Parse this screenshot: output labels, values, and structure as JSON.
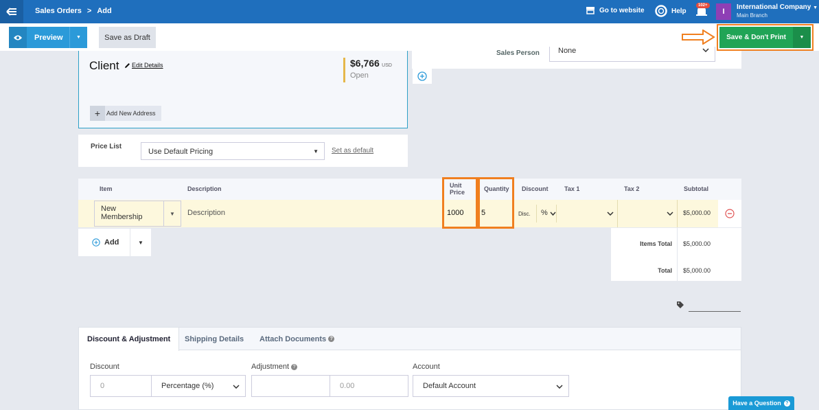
{
  "topbar": {
    "breadcrumb_section": "Sales Orders",
    "breadcrumb_separator": ">",
    "breadcrumb_page": "Add",
    "go_to_website": "Go to website",
    "help": "Help",
    "notification_count": "102+",
    "company_initial": "I",
    "company_name": "International Company",
    "company_branch": "Main Branch"
  },
  "toolbar": {
    "preview_label": "Preview",
    "save_draft_label": "Save as Draft",
    "save_no_print_label": "Save & Don't Print"
  },
  "client": {
    "title": "Client",
    "edit_details": "Edit Details",
    "amount": "$6,766",
    "currency": "USD",
    "status": "Open",
    "add_address": "Add New Address"
  },
  "sales_person": {
    "label": "Sales Person",
    "value": "None"
  },
  "price_list": {
    "label": "Price List",
    "value": "Use Default Pricing",
    "set_default": "Set as default"
  },
  "items_table": {
    "headers": {
      "item": "Item",
      "description": "Description",
      "unit_price": "Unit Price",
      "quantity": "Quantity",
      "discount": "Discount",
      "tax1": "Tax 1",
      "tax2": "Tax 2",
      "subtotal": "Subtotal"
    },
    "rows": [
      {
        "item": "New Membership",
        "description": "Description",
        "unit_price": "1000",
        "quantity": "5",
        "discount_label": "Disc.",
        "discount_type": "%",
        "subtotal": "$5,000.00"
      }
    ],
    "add_label": "Add"
  },
  "totals": {
    "items_total_label": "Items Total",
    "items_total_value": "$5,000.00",
    "total_label": "Total",
    "total_value": "$5,000.00"
  },
  "tabs": {
    "discount_adjustment": "Discount & Adjustment",
    "shipping_details": "Shipping Details",
    "attach_documents": "Attach Documents"
  },
  "discount_form": {
    "discount_label": "Discount",
    "discount_placeholder": "0",
    "discount_type": "Percentage (%)",
    "adjustment_label": "Adjustment",
    "adjustment_placeholder": "0.00",
    "account_label": "Account",
    "account_value": "Default Account"
  },
  "help_widget": {
    "label": "Have a Question"
  },
  "colors": {
    "topbar": "#1f6fbd",
    "primary_blue": "#2b9ad9",
    "save_green": "#20a456",
    "highlight_orange": "#f07f1f",
    "row_yellow": "#fdf8dd"
  }
}
